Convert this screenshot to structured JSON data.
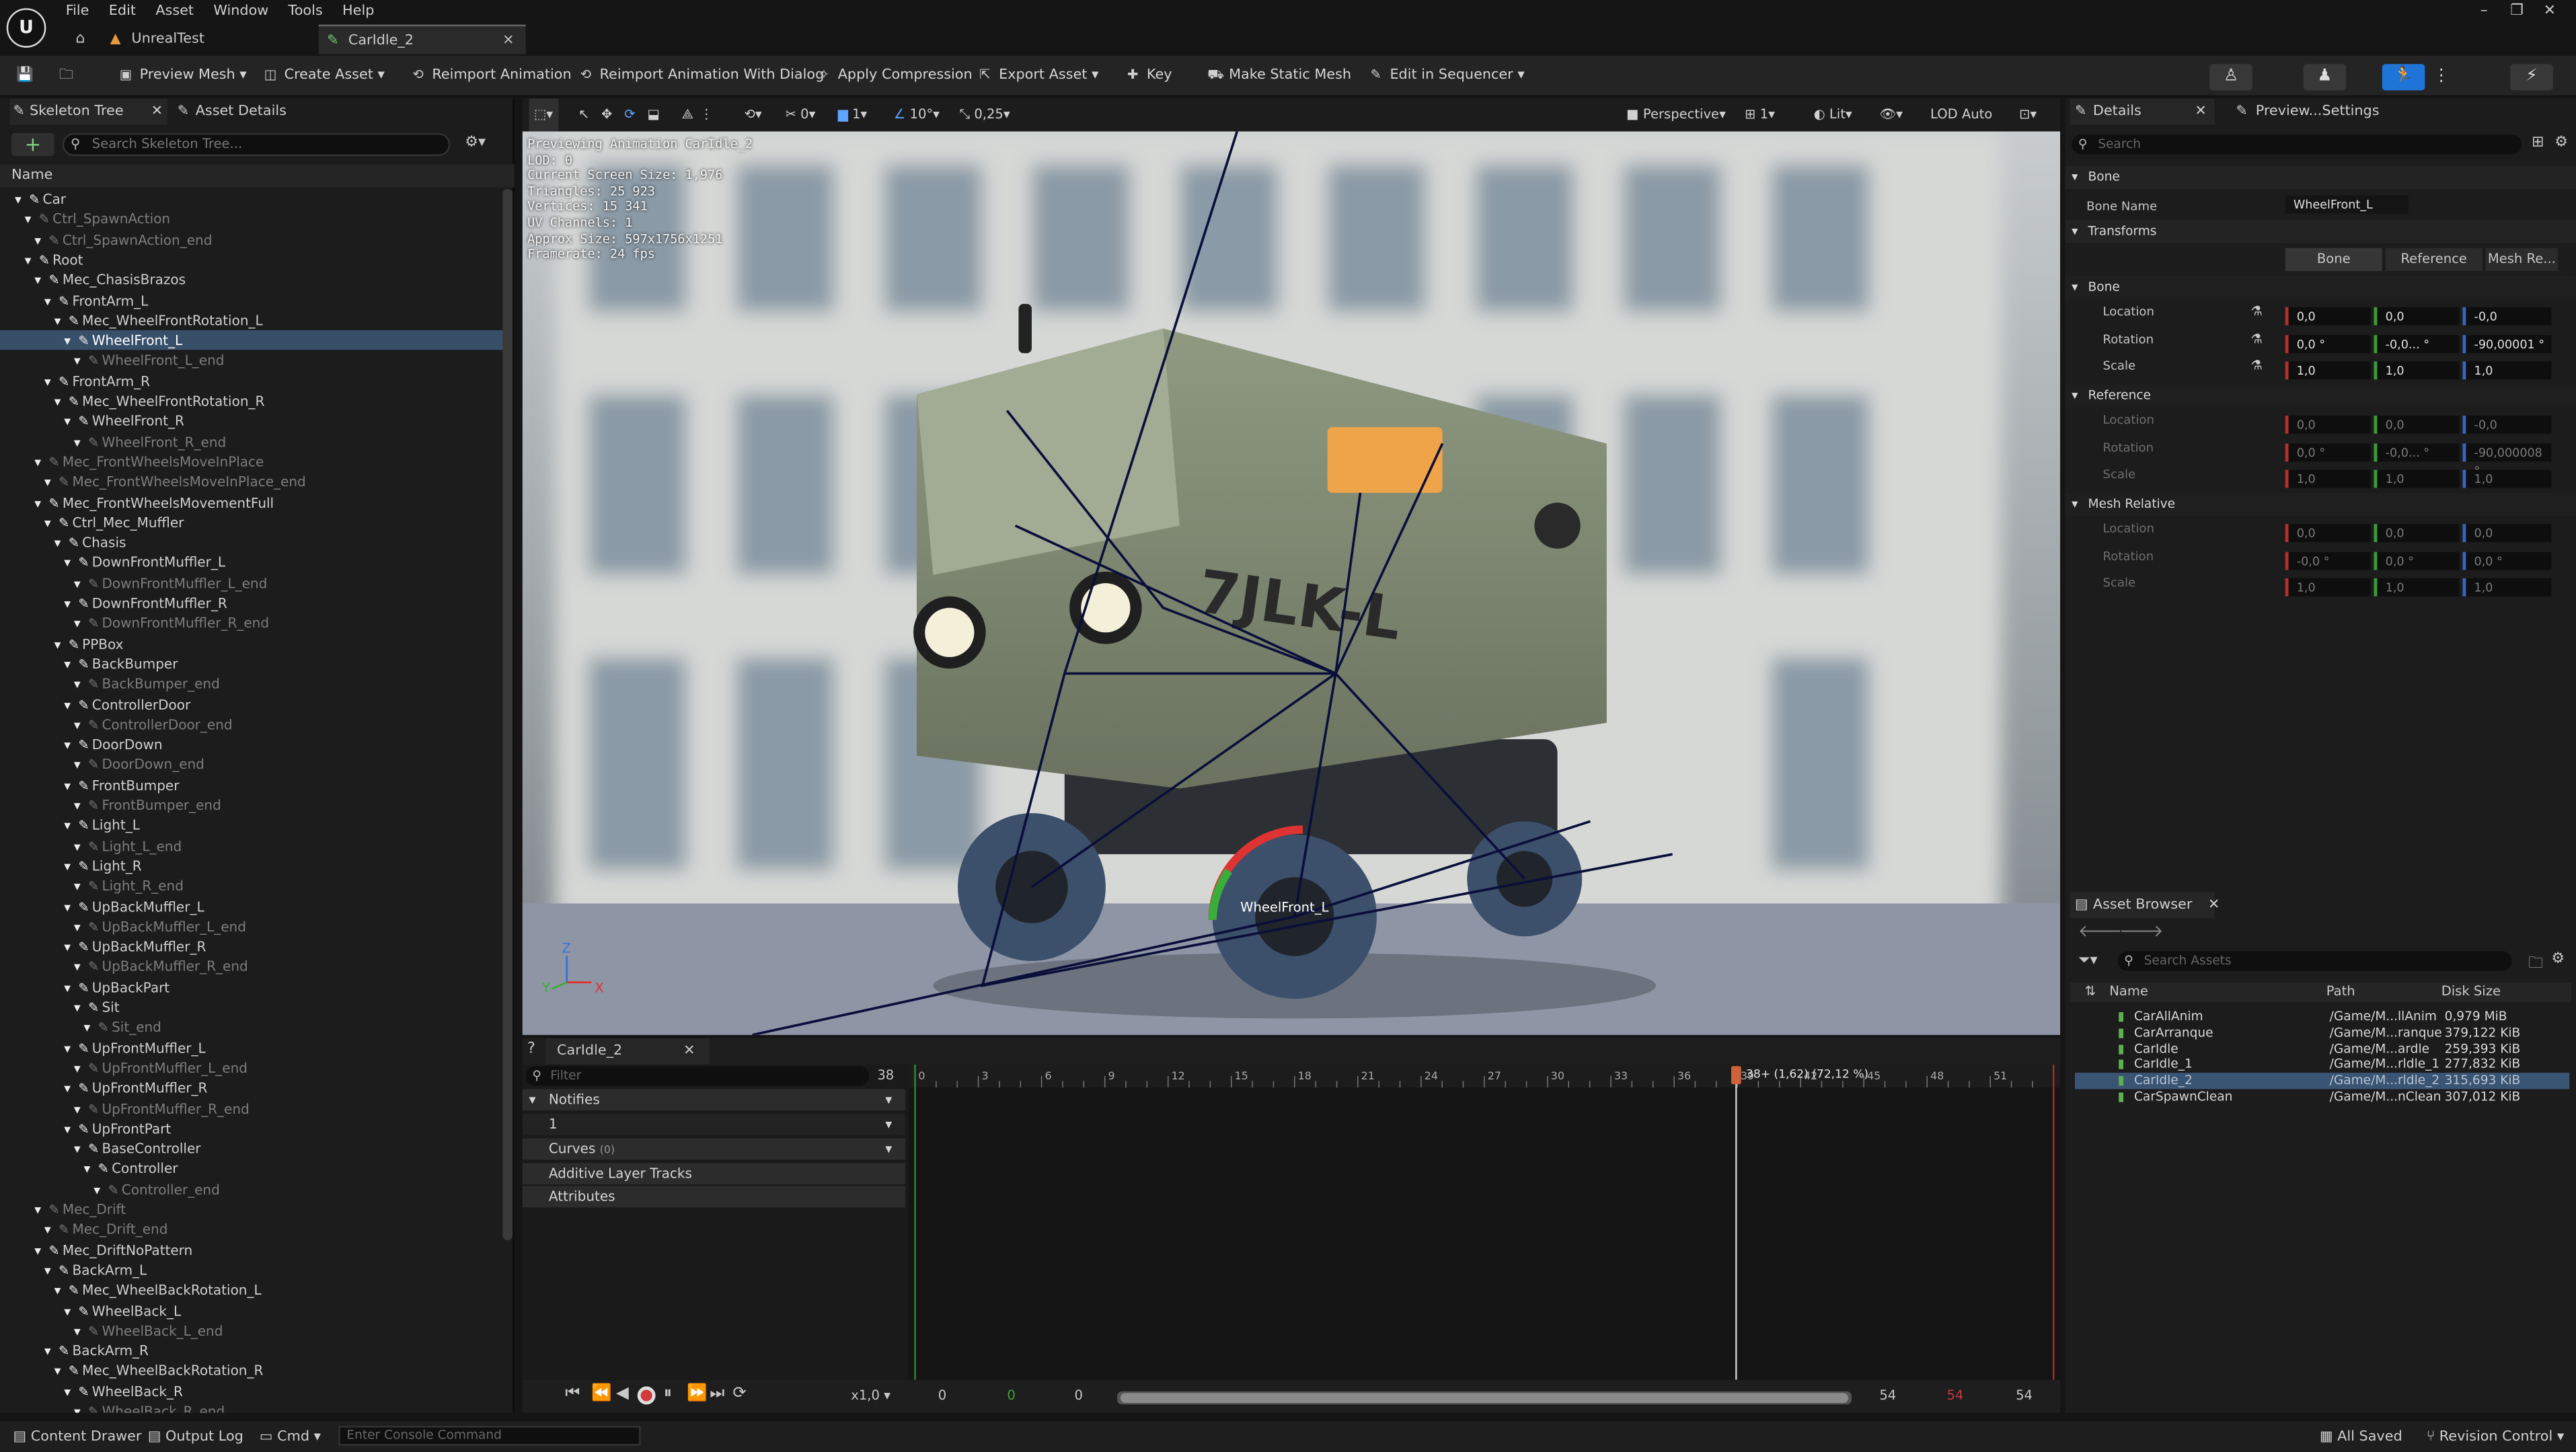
{
  "menu": [
    "File",
    "Edit",
    "Asset",
    "Window",
    "Tools",
    "Help"
  ],
  "logo": "U",
  "tabs": {
    "project": "UnrealTest",
    "asset": "CarIdle_2"
  },
  "window_controls": {
    "minimize": "–",
    "restore": "❐",
    "close": "✕"
  },
  "toolbar": {
    "preview_mesh": "Preview Mesh",
    "create_asset": "Create Asset",
    "reimport_animation": "Reimport Animation",
    "reimport_with_dialog": "Reimport Animation With Dialog",
    "apply_compression": "Apply Compression",
    "export_asset": "Export Asset",
    "key": "Key",
    "make_static_mesh": "Make Static Mesh",
    "edit_in_sequencer": "Edit in Sequencer"
  },
  "left_panel": {
    "tab_skeleton": "Skeleton Tree",
    "tab_asset_details": "Asset Details",
    "search_placeholder": "Search Skeleton Tree...",
    "name_header": "Name",
    "bones": [
      {
        "n": "Car",
        "d": 0
      },
      {
        "n": "Ctrl_SpawnAction",
        "d": 1,
        "dim": true
      },
      {
        "n": "Ctrl_SpawnAction_end",
        "d": 2,
        "dim": true
      },
      {
        "n": "Root",
        "d": 1
      },
      {
        "n": "Mec_ChasisBrazos",
        "d": 2
      },
      {
        "n": "FrontArm_L",
        "d": 3
      },
      {
        "n": "Mec_WheelFrontRotation_L",
        "d": 4
      },
      {
        "n": "WheelFront_L",
        "d": 5,
        "sel": true
      },
      {
        "n": "WheelFront_L_end",
        "d": 6,
        "dim": true
      },
      {
        "n": "FrontArm_R",
        "d": 3
      },
      {
        "n": "Mec_WheelFrontRotation_R",
        "d": 4
      },
      {
        "n": "WheelFront_R",
        "d": 5
      },
      {
        "n": "WheelFront_R_end",
        "d": 6,
        "dim": true
      },
      {
        "n": "Mec_FrontWheelsMoveInPlace",
        "d": 2,
        "dim": true
      },
      {
        "n": "Mec_FrontWheelsMoveInPlace_end",
        "d": 3,
        "dim": true
      },
      {
        "n": "Mec_FrontWheelsMovementFull",
        "d": 2
      },
      {
        "n": "Ctrl_Mec_Muffler",
        "d": 3
      },
      {
        "n": "Chasis",
        "d": 4
      },
      {
        "n": "DownFrontMuffler_L",
        "d": 5
      },
      {
        "n": "DownFrontMuffler_L_end",
        "d": 6,
        "dim": true
      },
      {
        "n": "DownFrontMuffler_R",
        "d": 5
      },
      {
        "n": "DownFrontMuffler_R_end",
        "d": 6,
        "dim": true
      },
      {
        "n": "PPBox",
        "d": 4
      },
      {
        "n": "BackBumper",
        "d": 5
      },
      {
        "n": "BackBumper_end",
        "d": 6,
        "dim": true
      },
      {
        "n": "ControllerDoor",
        "d": 5
      },
      {
        "n": "ControllerDoor_end",
        "d": 6,
        "dim": true
      },
      {
        "n": "DoorDown",
        "d": 5
      },
      {
        "n": "DoorDown_end",
        "d": 6,
        "dim": true
      },
      {
        "n": "FrontBumper",
        "d": 5
      },
      {
        "n": "FrontBumper_end",
        "d": 6,
        "dim": true
      },
      {
        "n": "Light_L",
        "d": 5
      },
      {
        "n": "Light_L_end",
        "d": 6,
        "dim": true
      },
      {
        "n": "Light_R",
        "d": 5
      },
      {
        "n": "Light_R_end",
        "d": 6,
        "dim": true
      },
      {
        "n": "UpBackMuffler_L",
        "d": 5
      },
      {
        "n": "UpBackMuffler_L_end",
        "d": 6,
        "dim": true
      },
      {
        "n": "UpBackMuffler_R",
        "d": 5
      },
      {
        "n": "UpBackMuffler_R_end",
        "d": 6,
        "dim": true
      },
      {
        "n": "UpBackPart",
        "d": 5
      },
      {
        "n": "Sit",
        "d": 6
      },
      {
        "n": "Sit_end",
        "d": 7,
        "dim": true
      },
      {
        "n": "UpFrontMuffler_L",
        "d": 5
      },
      {
        "n": "UpFrontMuffler_L_end",
        "d": 6,
        "dim": true
      },
      {
        "n": "UpFrontMuffler_R",
        "d": 5
      },
      {
        "n": "UpFrontMuffler_R_end",
        "d": 6,
        "dim": true
      },
      {
        "n": "UpFrontPart",
        "d": 5
      },
      {
        "n": "BaseController",
        "d": 6
      },
      {
        "n": "Controller",
        "d": 7
      },
      {
        "n": "Controller_end",
        "d": 8,
        "dim": true
      },
      {
        "n": "Mec_Drift",
        "d": 2,
        "dim": true
      },
      {
        "n": "Mec_Drift_end",
        "d": 3,
        "dim": true
      },
      {
        "n": "Mec_DriftNoPattern",
        "d": 2
      },
      {
        "n": "BackArm_L",
        "d": 3
      },
      {
        "n": "Mec_WheelBackRotation_L",
        "d": 4
      },
      {
        "n": "WheelBack_L",
        "d": 5
      },
      {
        "n": "WheelBack_L_end",
        "d": 6,
        "dim": true
      },
      {
        "n": "BackArm_R",
        "d": 3
      },
      {
        "n": "Mec_WheelBackRotation_R",
        "d": 4
      },
      {
        "n": "WheelBack_R",
        "d": 5
      },
      {
        "n": "WheelBack_R_end",
        "d": 6,
        "dim": true
      }
    ]
  },
  "viewport": {
    "perspective": "Perspective",
    "lit": "Lit",
    "lod": "LOD Auto",
    "snap_grid": "0",
    "snap_rot": "10°",
    "snap_scale": "0,25",
    "cam_speed": "1",
    "fov_1": "1",
    "stats": [
      "Previewing Animation CarIdle_2",
      "LOD: 0",
      "Current Screen Size: 1,976",
      "Triangles: 25 923",
      "Vertices: 15 341",
      "UV Channels: 1",
      "Approx Size: 597x1756x1251",
      "Framerate: 24 fps"
    ],
    "bone_label": "WheelFront_L",
    "axis": {
      "z": "Z",
      "y": "Y",
      "x": "X"
    }
  },
  "anim": {
    "tab": "CarIdle_2",
    "filter_placeholder": "Filter",
    "frame_indicator": "38",
    "notifies": "Notifies",
    "notify_track": "1",
    "curves": "Curves",
    "curves_count": "(0)",
    "additive": "Additive Layer Tracks",
    "attributes": "Attributes",
    "ticks": [
      "0",
      "3",
      "6",
      "9",
      "12",
      "15",
      "18",
      "21",
      "24",
      "27",
      "30",
      "33",
      "36",
      "39",
      "42",
      "45",
      "48",
      "51"
    ],
    "playhead_label": "38+ (1,62) (72,12 %)",
    "playhead_fraction": 0.7212,
    "speed": "x1,0",
    "range_start": "0",
    "range_green": "0",
    "range_start2": "0",
    "range_end": "54",
    "range_red": "54",
    "range_end2": "54"
  },
  "details": {
    "tab": "Details",
    "tab2": "Preview...Settings",
    "search_placeholder": "Search",
    "sec_bone": "Bone",
    "bone_name_label": "Bone Name",
    "bone_name": "WheelFront_L",
    "sec_transforms": "Transforms",
    "btn_bone": "Bone",
    "btn_reference": "Reference",
    "btn_mesh": "Mesh Re...",
    "sub_bone": "Bone",
    "sub_reference": "Reference",
    "sub_mesh": "Mesh Relative",
    "location": "Location",
    "rotation": "Rotation",
    "scale": "Scale",
    "bone_loc": [
      "0,0",
      "0,0",
      "-0,0"
    ],
    "bone_rot": [
      "0,0 °",
      "-0,0... °",
      "-90,00001 °"
    ],
    "bone_scale": [
      "1,0",
      "1,0",
      "1,0"
    ],
    "ref_loc": [
      "0,0",
      "0,0",
      "-0,0"
    ],
    "ref_rot": [
      "0,0 °",
      "-0,0... °",
      "-90,000008 °"
    ],
    "ref_scale": [
      "1,0",
      "1,0",
      "1,0"
    ],
    "mesh_loc": [
      "0,0",
      "0,0",
      "0,0"
    ],
    "mesh_rot": [
      "-0,0 °",
      "0,0 °",
      "0,0 °"
    ],
    "mesh_scale": [
      "1,0",
      "1,0",
      "1,0"
    ]
  },
  "asset_browser": {
    "tab": "Asset Browser",
    "search_placeholder": "Search Assets",
    "col_name": "Name",
    "col_path": "Path",
    "col_size": "Disk Size",
    "rows": [
      {
        "name": "CarAllAnim",
        "path": "/Game/M...llAnim",
        "size": "0,979 MiB"
      },
      {
        "name": "CarArranque",
        "path": "/Game/M...ranque",
        "size": "379,122 KiB"
      },
      {
        "name": "CarIdle",
        "path": "/Game/M...ardle",
        "size": "259,393 KiB"
      },
      {
        "name": "CarIdle_1",
        "path": "/Game/M...rldle_1",
        "size": "277,832 KiB"
      },
      {
        "name": "CarIdle_2",
        "path": "/Game/M...rldle_2",
        "size": "315,693 KiB",
        "sel": true
      },
      {
        "name": "CarSpawnClean",
        "path": "/Game/M...nClean",
        "size": "307,012 KiB"
      }
    ]
  },
  "statusbar": {
    "content_drawer": "Content Drawer",
    "output_log": "Output Log",
    "cmd": "Cmd",
    "console_placeholder": "Enter Console Command",
    "all_saved": "All Saved",
    "revision_control": "Revision Control"
  }
}
